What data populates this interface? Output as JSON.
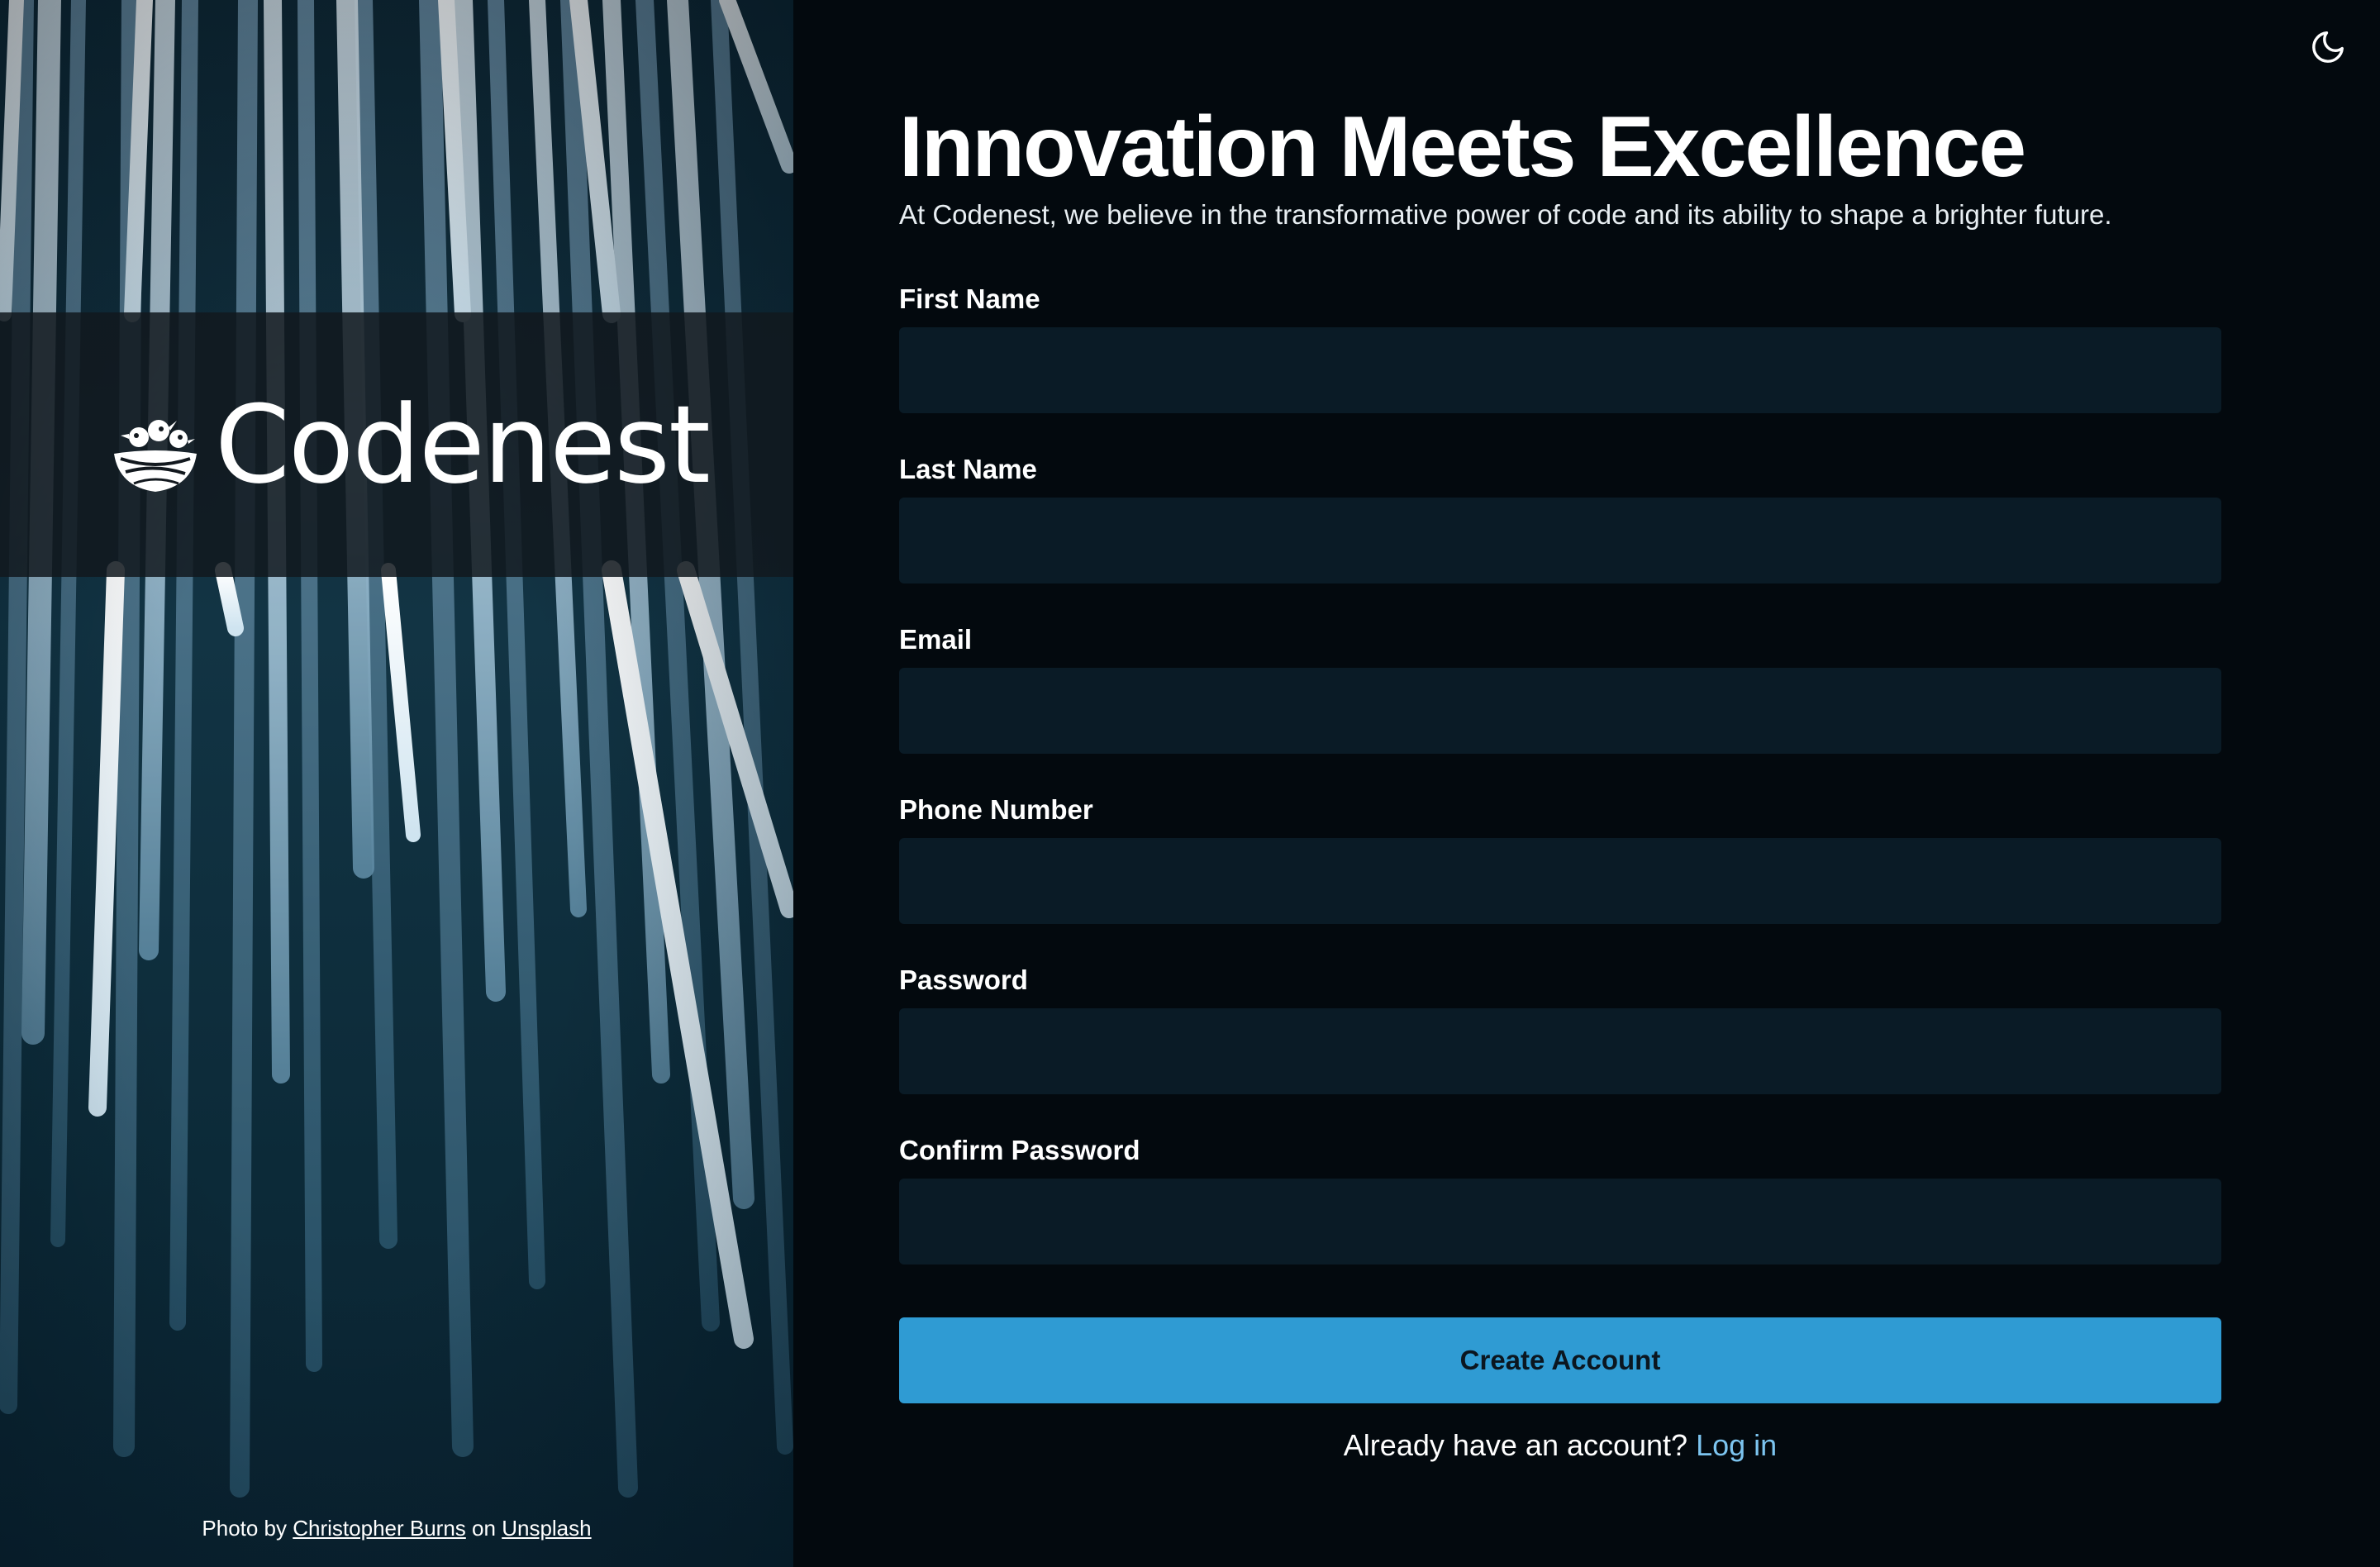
{
  "brand": {
    "name": "Codenest"
  },
  "photo_credit": {
    "prefix": "Photo by",
    "author": "Christopher Burns",
    "middle": "on",
    "site": "Unsplash"
  },
  "header": {
    "theme_toggle_icon": "moon-icon"
  },
  "hero": {
    "title": "Innovation Meets Excellence",
    "subtitle": "At Codenest, we believe in the transformative power of code and its ability to shape a brighter future."
  },
  "form": {
    "fields": [
      {
        "label": "First Name",
        "value": "",
        "placeholder": ""
      },
      {
        "label": "Last Name",
        "value": "",
        "placeholder": ""
      },
      {
        "label": "Email",
        "value": "",
        "placeholder": ""
      },
      {
        "label": "Phone Number",
        "value": "",
        "placeholder": ""
      },
      {
        "label": "Password",
        "value": "",
        "placeholder": ""
      },
      {
        "label": "Confirm Password",
        "value": "",
        "placeholder": ""
      }
    ],
    "submit_label": "Create Account",
    "login_prompt": "Already have an account?",
    "login_link": "Log in"
  },
  "colors": {
    "background": "#03090e",
    "input_background": "#0a1b26",
    "accent": "#2f9bd3",
    "link": "#7cc4ef"
  }
}
